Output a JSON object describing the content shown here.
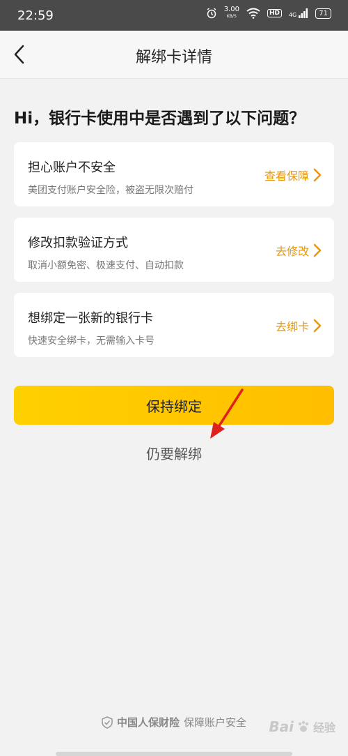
{
  "status_bar": {
    "time": "22:59",
    "net_speed": "3.00",
    "net_unit": "KB/S",
    "hd": "HD",
    "signal": "4G",
    "battery": "71"
  },
  "nav": {
    "title": "解绑卡详情"
  },
  "headline": "Hi，银行卡使用中是否遇到了以下问题？",
  "cards": [
    {
      "title": "担心账户不安全",
      "subtitle": "美团支付账户安全险，被盗无限次赔付",
      "action": "查看保障"
    },
    {
      "title": "修改扣款验证方式",
      "subtitle": "取消小额免密、极速支付、自动扣款",
      "action": "去修改"
    },
    {
      "title": "想绑定一张新的银行卡",
      "subtitle": "快速安全绑卡，无需输入卡号",
      "action": "去绑卡"
    }
  ],
  "buttons": {
    "keep": "保持绑定",
    "unbind": "仍要解绑"
  },
  "footer": {
    "brand": "中国人保财险",
    "text": "保障账户安全"
  },
  "watermark": {
    "text": "Bai",
    "suffix": "经验"
  },
  "colors": {
    "accent": "#ffc800",
    "action": "#e8970a",
    "arrow": "#e0201b"
  }
}
